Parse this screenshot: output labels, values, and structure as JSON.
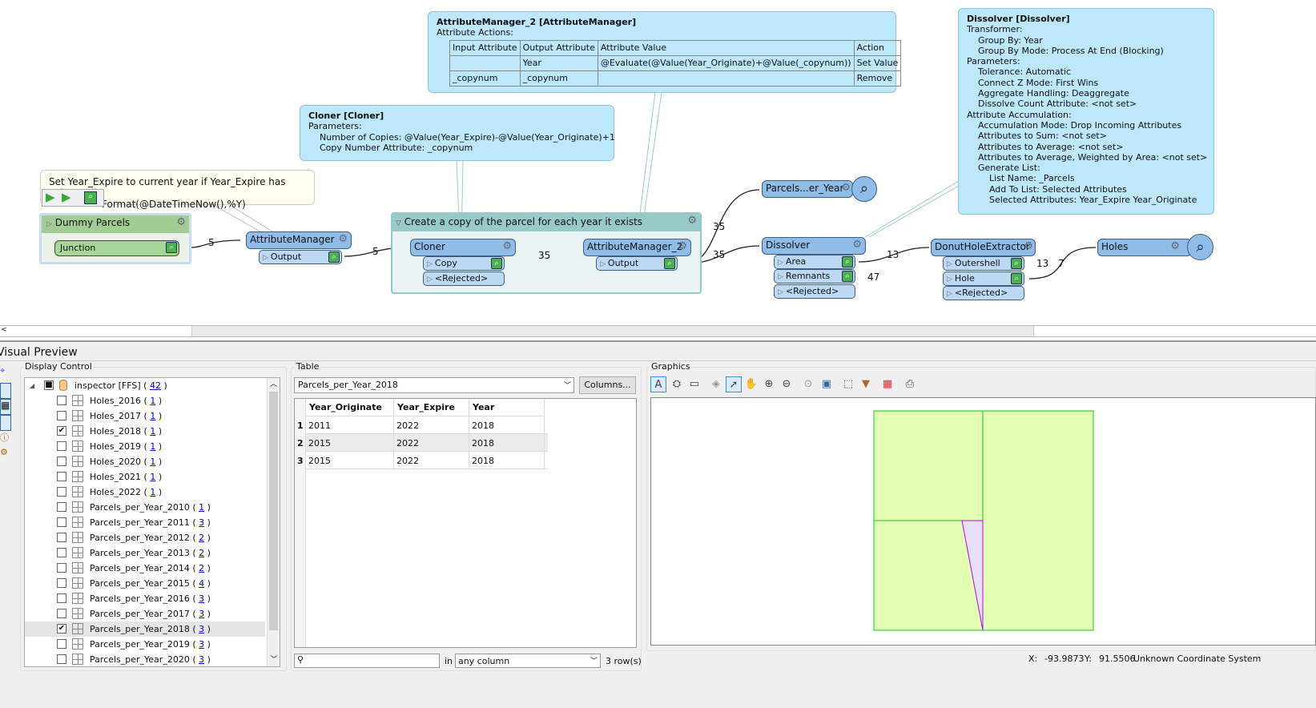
{
  "canvas": {
    "annotation_note": {
      "line1": "Set Year_Expire to current year if Year_Expire has value Null",
      "line2": "Format(@DateTimeNow(),%Y)"
    },
    "attrmgr_tip": {
      "title": "AttributeManager_2 [AttributeManager]",
      "subtitle": "Attribute Actions:",
      "headers": [
        "Input Attribute",
        "Output Attribute",
        "Attribute Value",
        "Action"
      ],
      "rows": [
        [
          "",
          "Year",
          "@Evaluate(@Value(Year_Originate)+@Value(_copynum))",
          "Set Value"
        ],
        [
          "_copynum",
          "_copynum",
          "",
          "Remove"
        ]
      ]
    },
    "cloner_tip": {
      "title": "Cloner [Cloner]",
      "body": "Parameters:\n    Number of Copies: @Value(Year_Expire)-@Value(Year_Originate)+1\n    Copy Number Attribute: _copynum"
    },
    "dissolver_tip": {
      "title": "Dissolver [Dissolver]",
      "body": "Transformer:\n    Group By: Year\n    Group By Mode: Process At End (Blocking)\nParameters:\n    Tolerance: Automatic\n    Connect Z Mode: First Wins\n    Aggregate Handling: Deaggregate\n    Dissolve Count Attribute: <not set>\nAttribute Accumulation:\n    Accumulation Mode: Drop Incoming Attributes\n    Attributes to Sum: <not set>\n    Attributes to Average: <not set>\n    Attributes to Average, Weighted by Area: <not set>\n    Generate List:\n        List Name: _Parcels\n        Add To List: Selected Attributes\n        Selected Attributes: Year_Expire Year_Originate"
    },
    "bookmark_dummy": {
      "title": "Dummy Parcels",
      "junction": "Junction"
    },
    "bookmark_group": {
      "title": "Create a copy of the parcel for each year it exists"
    },
    "transformers": {
      "attributemanager": {
        "name": "AttributeManager",
        "ports": [
          "Output"
        ]
      },
      "cloner": {
        "name": "Cloner",
        "ports": [
          "Copy",
          "<Rejected>"
        ]
      },
      "attributemanager2": {
        "name": "AttributeManager_2",
        "ports": [
          "Output"
        ]
      },
      "dissolver": {
        "name": "Dissolver",
        "ports": [
          "Area",
          "Remnants",
          "<Rejected>"
        ]
      },
      "donut": {
        "name": "DonutHoleExtractor",
        "ports": [
          "Outershell",
          "Hole",
          "<Rejected>"
        ]
      },
      "parcels_writer": {
        "name": "Parcels...er_Year"
      },
      "holes_writer": {
        "name": "Holes"
      }
    },
    "counts": {
      "junction_out": "5",
      "am_out": "5",
      "copy_out": "35",
      "am2_out_a": "35",
      "am2_out_b": "35",
      "area_out": "13",
      "remnants_out": "47",
      "outershell_out": "13",
      "hole_out": "7"
    }
  },
  "preview": {
    "title": "Visual Preview",
    "display_control": {
      "label": "Display Control",
      "root": {
        "name": "inspector [FFS]",
        "count": "42"
      },
      "items": [
        {
          "name": "Holes_2016",
          "count": "1",
          "checked": false
        },
        {
          "name": "Holes_2017",
          "count": "1",
          "checked": false
        },
        {
          "name": "Holes_2018",
          "count": "1",
          "checked": true
        },
        {
          "name": "Holes_2019",
          "count": "1",
          "checked": false
        },
        {
          "name": "Holes_2020",
          "count": "1",
          "checked": false
        },
        {
          "name": "Holes_2021",
          "count": "1",
          "checked": false
        },
        {
          "name": "Holes_2022",
          "count": "1",
          "checked": false
        },
        {
          "name": "Parcels_per_Year_2010",
          "count": "1",
          "checked": false
        },
        {
          "name": "Parcels_per_Year_2011",
          "count": "3",
          "checked": false
        },
        {
          "name": "Parcels_per_Year_2012",
          "count": "2",
          "checked": false
        },
        {
          "name": "Parcels_per_Year_2013",
          "count": "2",
          "checked": false
        },
        {
          "name": "Parcels_per_Year_2014",
          "count": "2",
          "checked": false
        },
        {
          "name": "Parcels_per_Year_2015",
          "count": "4",
          "checked": false
        },
        {
          "name": "Parcels_per_Year_2016",
          "count": "3",
          "checked": false
        },
        {
          "name": "Parcels_per_Year_2017",
          "count": "3",
          "checked": false
        },
        {
          "name": "Parcels_per_Year_2018",
          "count": "3",
          "checked": true,
          "selected": true
        },
        {
          "name": "Parcels_per_Year_2019",
          "count": "3",
          "checked": false
        },
        {
          "name": "Parcels_per_Year_2020",
          "count": "3",
          "checked": false
        }
      ]
    },
    "table": {
      "label": "Table",
      "selected_table": "Parcels_per_Year_2018",
      "columns_button": "Columns...",
      "headers": [
        "Year_Originate",
        "Year_Expire",
        "Year"
      ],
      "rows": [
        [
          "1",
          "2011",
          "2022",
          "2018"
        ],
        [
          "2",
          "2015",
          "2022",
          "2018"
        ],
        [
          "3",
          "2015",
          "2022",
          "2018"
        ]
      ],
      "search_value": "",
      "in_label": "in",
      "column_filter": "any column",
      "row_count": "3 row(s)"
    },
    "graphics": {
      "label": "Graphics",
      "fill_color": "#e3ffb3",
      "stroke_color": "#1fbf1f",
      "hole_color": "#c000ff",
      "status": {
        "x_label": "X:",
        "x_value": "-93.9873",
        "y_label": "Y:",
        "y_value": "91.5506",
        "crs": "Unknown Coordinate System"
      }
    }
  }
}
